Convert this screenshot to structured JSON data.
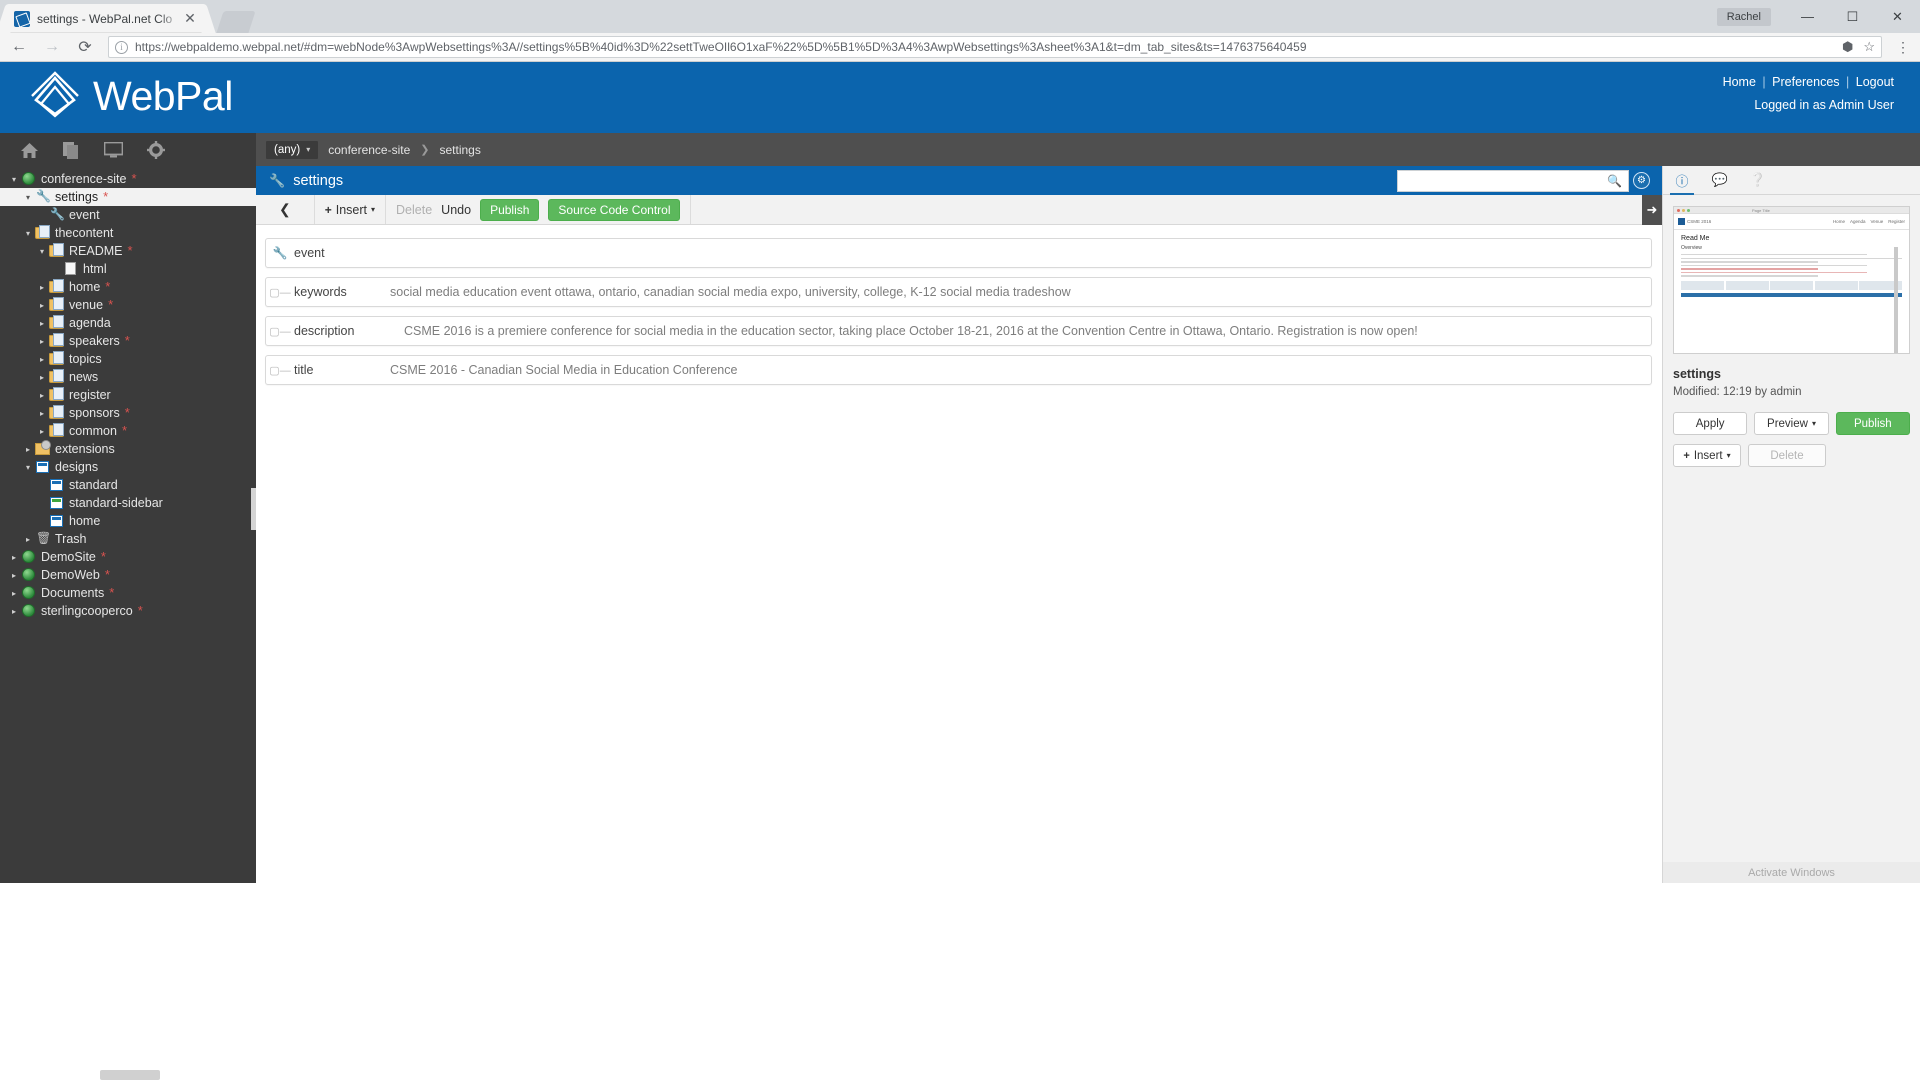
{
  "browser": {
    "tab_title": "settings - WebPal.net Clo",
    "tab_close_icon": "close-icon",
    "url": "https://webpaldemo.webpal.net/#dm=webNode%3AwpWebsettings%3A//settings%5B%40id%3D%22settTweOIl6O1xaF%22%5D%5B1%5D%3A4%3AwpWebsettings%3Asheet%3A1&t=dm_tab_sites&ts=1476375640459",
    "user_chip": "Rachel",
    "back_icon": "back-arrow-icon",
    "forward_icon": "forward-arrow-icon",
    "reload_icon": "reload-icon",
    "site_info_icon": "site-info-icon",
    "extension_icon": "extension-icon",
    "bookmark_icon": "star-icon",
    "menu_icon": "kebab-menu-icon",
    "minimize_icon": "minimize-icon",
    "maximize_icon": "maximize-icon",
    "close_icon": "window-close-icon"
  },
  "header": {
    "brand": "WebPal",
    "links": [
      {
        "label": "Home"
      },
      {
        "label": "Preferences"
      },
      {
        "label": "Logout"
      }
    ],
    "separator": "|",
    "logged_in": "Logged in as Admin User",
    "brand_color": "#0b64ad"
  },
  "sidebar": {
    "icons": [
      {
        "name": "home-icon",
        "glyph": "⌂"
      },
      {
        "name": "copy-icon",
        "glyph": "❐"
      },
      {
        "name": "monitor-icon",
        "glyph": "▭"
      },
      {
        "name": "gear-icon",
        "glyph": "⚙"
      }
    ],
    "tree": [
      {
        "label": "conference-site",
        "icon": "globe",
        "twisty": "down",
        "indent": 0,
        "modified": true,
        "selected": false
      },
      {
        "label": "settings",
        "icon": "wrench",
        "twisty": "down",
        "indent": 1,
        "modified": true,
        "selected": true
      },
      {
        "label": "event",
        "icon": "wrench",
        "twisty": "none",
        "indent": 2,
        "modified": false,
        "selected": false
      },
      {
        "label": "thecontent",
        "icon": "folder",
        "twisty": "down",
        "indent": 1,
        "modified": false,
        "selected": false
      },
      {
        "label": "README",
        "icon": "folder",
        "twisty": "down",
        "indent": 2,
        "modified": true,
        "selected": false
      },
      {
        "label": "html",
        "icon": "doc",
        "twisty": "none",
        "indent": 3,
        "modified": false,
        "selected": false
      },
      {
        "label": "home",
        "icon": "folder",
        "twisty": "right",
        "indent": 2,
        "modified": true,
        "selected": false
      },
      {
        "label": "venue",
        "icon": "folder",
        "twisty": "right",
        "indent": 2,
        "modified": true,
        "selected": false
      },
      {
        "label": "agenda",
        "icon": "folder",
        "twisty": "right",
        "indent": 2,
        "modified": false,
        "selected": false
      },
      {
        "label": "speakers",
        "icon": "folder",
        "twisty": "right",
        "indent": 2,
        "modified": true,
        "selected": false
      },
      {
        "label": "topics",
        "icon": "folder",
        "twisty": "right",
        "indent": 2,
        "modified": false,
        "selected": false
      },
      {
        "label": "news",
        "icon": "folder",
        "twisty": "right",
        "indent": 2,
        "modified": false,
        "selected": false
      },
      {
        "label": "register",
        "icon": "folder",
        "twisty": "right",
        "indent": 2,
        "modified": false,
        "selected": false
      },
      {
        "label": "sponsors",
        "icon": "folder",
        "twisty": "right",
        "indent": 2,
        "modified": true,
        "selected": false
      },
      {
        "label": "common",
        "icon": "folder",
        "twisty": "right",
        "indent": 2,
        "modified": true,
        "selected": false
      },
      {
        "label": "extensions",
        "icon": "ext",
        "twisty": "right",
        "indent": 1,
        "modified": false,
        "selected": false
      },
      {
        "label": "designs",
        "icon": "design-blue",
        "twisty": "down",
        "indent": 1,
        "modified": false,
        "selected": false
      },
      {
        "label": "standard",
        "icon": "design-blue",
        "twisty": "none",
        "indent": 2,
        "modified": false,
        "selected": false
      },
      {
        "label": "standard-sidebar",
        "icon": "design-green",
        "twisty": "none",
        "indent": 2,
        "modified": false,
        "selected": false
      },
      {
        "label": "home",
        "icon": "design-blue",
        "twisty": "none",
        "indent": 2,
        "modified": false,
        "selected": false
      },
      {
        "label": "Trash",
        "icon": "trash",
        "twisty": "right",
        "indent": 1,
        "modified": false,
        "selected": false
      },
      {
        "label": "DemoSite",
        "icon": "globe",
        "twisty": "right",
        "indent": 0,
        "modified": true,
        "selected": false
      },
      {
        "label": "DemoWeb",
        "icon": "globe",
        "twisty": "right",
        "indent": 0,
        "modified": true,
        "selected": false
      },
      {
        "label": "Documents",
        "icon": "globe",
        "twisty": "right",
        "indent": 0,
        "modified": true,
        "selected": false
      },
      {
        "label": "sterlingcooperco",
        "icon": "globe",
        "twisty": "right",
        "indent": 0,
        "modified": true,
        "selected": false
      }
    ],
    "modified_marker": "*"
  },
  "breadcrumb": {
    "scope_label": "(any)",
    "scope_caret": "▾",
    "items": [
      {
        "label": "conference-site"
      },
      {
        "label": "settings"
      }
    ],
    "separator": "❯"
  },
  "panel": {
    "title": "settings",
    "title_icon": "wrench-icon",
    "search_placeholder": "",
    "search_value": "",
    "search_icon": "search-icon",
    "settings_icon": "gear-circle-icon"
  },
  "toolbar": {
    "back_icon": "chevron-left-icon",
    "insert_label": "Insert",
    "insert_plus": "+",
    "insert_caret": "▾",
    "delete_label": "Delete",
    "undo_label": "Undo",
    "publish_label": "Publish",
    "source_code_control_label": "Source Code Control",
    "collapse_icon": "arrow-right-icon",
    "green_color": "#5cb85c"
  },
  "fields": [
    {
      "icon": "wrench-icon",
      "name": "event",
      "value": ""
    },
    {
      "icon": "tag-icon",
      "name": "keywords",
      "value": "social media education event ottawa, ontario, canadian social media expo, university, college, K-12 social media tradeshow"
    },
    {
      "icon": "tag-icon",
      "name": "description",
      "value": "CSME 2016 is a premiere conference for social media in the education sector, taking place October 18-21, 2016 at the Convention Centre in Ottawa, Ontario. Registration is now open!"
    },
    {
      "icon": "tag-icon",
      "name": "title",
      "value": "CSME 2016 - Canadian Social Media in Education Conference"
    }
  ],
  "right_panel": {
    "tabs": [
      {
        "name": "info-tab",
        "glyph": "ℹ",
        "active": true
      },
      {
        "name": "comments-tab",
        "glyph": "💬",
        "active": false
      },
      {
        "name": "help-tab",
        "glyph": "?",
        "active": false
      }
    ],
    "thumbnail": {
      "window_title": "Page Title",
      "logo_text": "CSME 2016",
      "nav_items": [
        "Home",
        "Agenda",
        "Venue",
        "Register"
      ],
      "heading": "Read Me",
      "subheading": "Overview"
    },
    "node_name": "settings",
    "modified_text": "Modified: 12:19 by admin",
    "buttons": [
      {
        "name": "apply-button",
        "label": "Apply",
        "style": "default"
      },
      {
        "name": "preview-button",
        "label": "Preview",
        "style": "default",
        "caret": "▾"
      },
      {
        "name": "publish-button",
        "label": "Publish",
        "style": "green"
      }
    ],
    "buttons2": [
      {
        "name": "insert-button",
        "label": "Insert",
        "plus": "+",
        "caret": "▾",
        "disabled": false
      },
      {
        "name": "delete-button",
        "label": "Delete",
        "disabled": true
      }
    ],
    "watermark": "Activate Windows"
  }
}
